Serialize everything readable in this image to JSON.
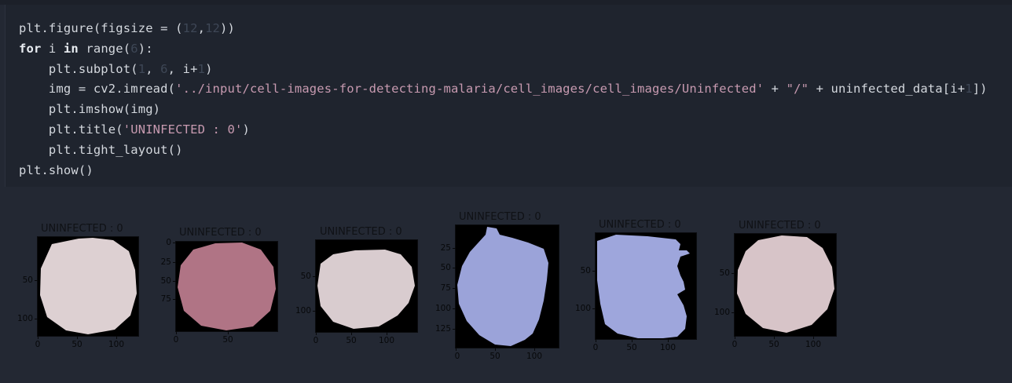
{
  "code": [
    [
      {
        "t": "plt.figure(figsize = ("
      },
      {
        "t": "12",
        "c": "num"
      },
      {
        "t": ","
      },
      {
        "t": "12",
        "c": "num"
      },
      {
        "t": "))"
      }
    ],
    [
      {
        "t": "for",
        "c": "kw"
      },
      {
        "t": " i "
      },
      {
        "t": "in",
        "c": "kw"
      },
      {
        "t": " range("
      },
      {
        "t": "6",
        "c": "num"
      },
      {
        "t": "):"
      }
    ],
    [
      {
        "t": "    plt.subplot("
      },
      {
        "t": "1",
        "c": "num"
      },
      {
        "t": ", "
      },
      {
        "t": "6",
        "c": "num"
      },
      {
        "t": ", i+"
      },
      {
        "t": "1",
        "c": "num"
      },
      {
        "t": ")"
      }
    ],
    [
      {
        "t": "    img = cv2.imread("
      },
      {
        "t": "'../input/cell-images-for-detecting-malaria/cell_images/cell_images/Uninfected'",
        "c": "str"
      },
      {
        "t": " + "
      },
      {
        "t": "\"/\"",
        "c": "str"
      },
      {
        "t": " + uninfected_data[i+"
      },
      {
        "t": "1",
        "c": "num"
      },
      {
        "t": "])"
      }
    ],
    [
      {
        "t": "    plt.imshow(img)"
      }
    ],
    [
      {
        "t": "    plt.title("
      },
      {
        "t": "'UNINFECTED : 0'",
        "c": "str"
      },
      {
        "t": ")"
      }
    ],
    [
      {
        "t": "    plt.tight_layout()"
      }
    ],
    [
      {
        "t": "plt.show()"
      }
    ]
  ],
  "subplots": [
    {
      "title": "UNINFECTED : 0",
      "xticks": [
        "0",
        "50",
        "100"
      ],
      "yticks": [
        "50",
        "100"
      ],
      "color": "#ddd0d2"
    },
    {
      "title": "UNINFECTED : 0",
      "xticks": [
        "0",
        "50"
      ],
      "yticks": [
        "0",
        "25",
        "50",
        "75"
      ],
      "color": "#b07485"
    },
    {
      "title": "UNINFECTED : 0",
      "xticks": [
        "0",
        "50",
        "100"
      ],
      "yticks": [
        "50",
        "100"
      ],
      "color": "#d9cccf"
    },
    {
      "title": "UNINFECTED : 0",
      "xticks": [
        "0",
        "50",
        "100"
      ],
      "yticks": [
        "25",
        "50",
        "75",
        "100",
        "125"
      ],
      "color": "#9ba3d9"
    },
    {
      "title": "UNINFECTED : 0",
      "xticks": [
        "0",
        "50",
        "100"
      ],
      "yticks": [
        "50",
        "100"
      ],
      "color": "#9ea6dc"
    },
    {
      "title": "UNINFECTED : 0",
      "xticks": [
        "0",
        "50",
        "100"
      ],
      "yticks": [
        "50",
        "100"
      ],
      "color": "#d7c4c8"
    }
  ]
}
